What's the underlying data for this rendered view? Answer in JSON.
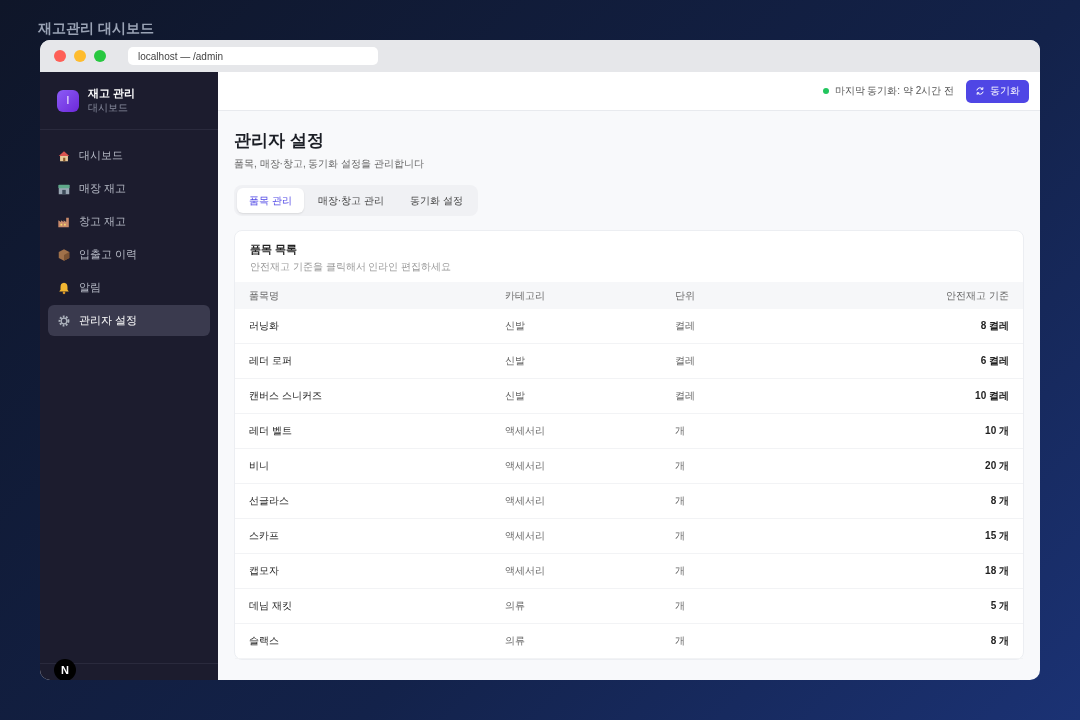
{
  "page_title": "재고관리 대시보드",
  "browser": {
    "url": "localhost — /admin"
  },
  "sidebar": {
    "logo_letter": "I",
    "app_name": "재고 관리",
    "app_sub": "대시보드",
    "items": [
      {
        "label": "대시보드",
        "selected": false
      },
      {
        "label": "매장 재고",
        "selected": false
      },
      {
        "label": "창고 재고",
        "selected": false
      },
      {
        "label": "입출고 이력",
        "selected": false
      },
      {
        "label": "알림",
        "selected": false
      },
      {
        "label": "관리자 설정",
        "selected": true
      }
    ],
    "dev_badge": "N"
  },
  "topbar": {
    "sync_status": "마지막 동기화: 약 2시간 전",
    "sync_button": "동기화"
  },
  "header": {
    "title": "관리자 설정",
    "subtitle": "품목, 매장·창고, 동기화 설정을 관리합니다"
  },
  "tabs": [
    {
      "label": "품목 관리",
      "selected": true
    },
    {
      "label": "매장·창고 관리",
      "selected": false
    },
    {
      "label": "동기화 설정",
      "selected": false
    }
  ],
  "card": {
    "title": "품목 목록",
    "hint": "안전재고 기준을 클릭해서 인라인 편집하세요",
    "columns": [
      "품목명",
      "카테고리",
      "단위",
      "안전재고 기준"
    ],
    "rows": [
      [
        "러닝화",
        "신발",
        "켤레",
        "8 켤레"
      ],
      [
        "레더 로퍼",
        "신발",
        "켤레",
        "6 켤레"
      ],
      [
        "캔버스 스니커즈",
        "신발",
        "켤레",
        "10 켤레"
      ],
      [
        "레더 벨트",
        "액세서리",
        "개",
        "10 개"
      ],
      [
        "비니",
        "액세서리",
        "개",
        "20 개"
      ],
      [
        "선글라스",
        "액세서리",
        "개",
        "8 개"
      ],
      [
        "스카프",
        "액세서리",
        "개",
        "15 개"
      ],
      [
        "캡모자",
        "액세서리",
        "개",
        "18 개"
      ],
      [
        "데님 재킷",
        "의류",
        "개",
        "5 개"
      ],
      [
        "슬랙스",
        "의류",
        "개",
        "8 개"
      ]
    ]
  }
}
